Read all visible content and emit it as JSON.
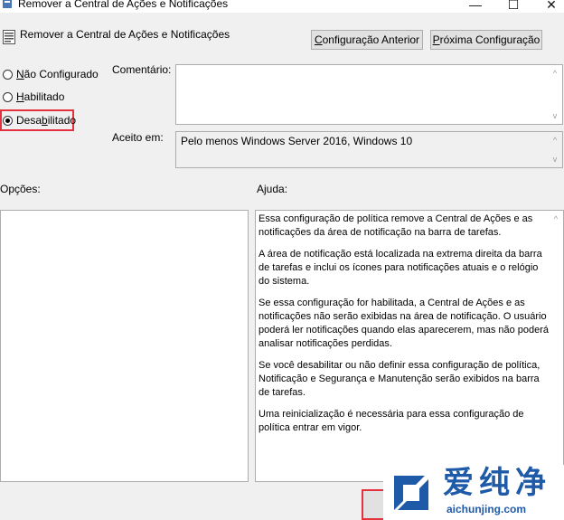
{
  "window": {
    "title": "Remover a Central de Ações e Notificações",
    "minimize_glyph": "—",
    "maximize_glyph": "☐",
    "close_glyph": "✕"
  },
  "header": {
    "title": "Remover a Central de Ações e Notificações",
    "prev_button": {
      "mnemonic": "C",
      "rest": "onfiguração Anterior"
    },
    "next_button": {
      "mnemonic": "P",
      "rest": "róxima Configuração"
    }
  },
  "state": {
    "options": [
      {
        "mnemonic": "N",
        "rest": "ão Configurado",
        "selected": false
      },
      {
        "mnemonic": "H",
        "rest": "abilitado",
        "selected": false
      },
      {
        "pre": "Desa",
        "mnemonic": "b",
        "rest": "ilitado",
        "selected": true
      }
    ]
  },
  "comment": {
    "label": "Comentário:",
    "value": ""
  },
  "supported": {
    "label": "Aceito em:",
    "value": "Pelo menos Windows Server 2016, Windows 10"
  },
  "options_label": "Opções:",
  "help_label": "Ajuda:",
  "help": {
    "paragraphs": [
      "Essa configuração de política remove a Central de Ações e as notificações da área de notificação na barra de tarefas.",
      "A área de notificação está localizada na extrema direita da barra de tarefas e inclui os ícones para notificações atuais e o relógio do sistema.",
      "Se essa configuração for habilitada, a Central de Ações e as notificações não serão exibidas na área de notificação. O usuário poderá ler notificações quando elas aparecerem, mas não poderá analisar notificações perdidas.",
      "Se você desabilitar ou não definir essa configuração de política, Notificação e Segurança e Manutenção serão exibidos na barra de tarefas.",
      "Uma reinicialização é necessária para essa configuração de política entrar em vigor."
    ]
  },
  "watermark": {
    "chinese": "爱纯净",
    "url": "aichunjing.com"
  },
  "colors": {
    "highlight": "#e3313d",
    "watermark": "#1f5aa8"
  }
}
